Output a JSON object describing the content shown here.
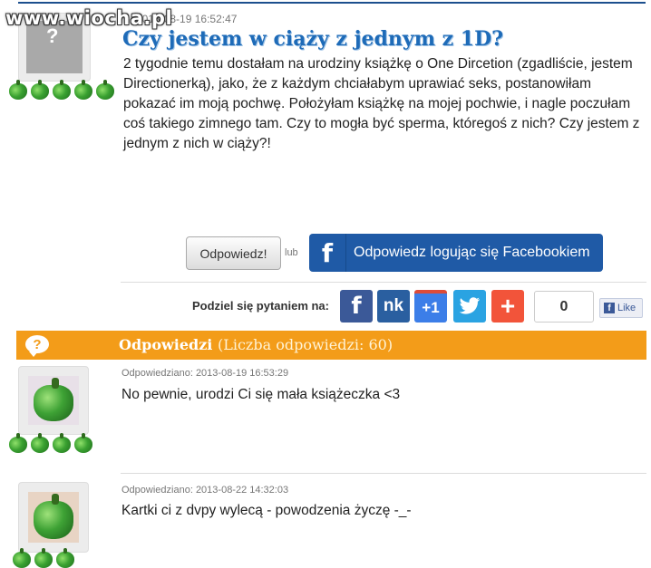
{
  "watermark": "www.wiocha.pl",
  "question": {
    "date": "2013-08-19 16:52:47",
    "title": "Czy jestem w ciąży z jednym z 1D?",
    "body": "2 tygodnie temu dostałam na urodziny książkę o One Dircetion (zgadliście, jestem Directionerką), jako, że z każdym chciałabym uprawiać seks, postanowiłam pokazać im moją pochwę. Położyłam książkę na mojej pochwie, i nagle poczułam coś takiego zimnego tam. Czy to mogła być sperma, któregoś z nich? Czy jestem z jednym z nich w ciąży?!",
    "rating_icons": 5
  },
  "actions": {
    "reply_label": "Odpowiedz!",
    "or_label": "lub",
    "facebook_label": "Odpowiedz logując się Facebookiem"
  },
  "share": {
    "label": "Podziel się pytaniem na:",
    "buttons": [
      {
        "icon": "facebook-icon",
        "text": "f",
        "color": "#3b5998"
      },
      {
        "icon": "nk-icon",
        "text": "nk",
        "color": "#2a5fa0"
      },
      {
        "icon": "google-plus-icon",
        "text": "+1",
        "color": "#3c7ee8"
      },
      {
        "icon": "twitter-icon",
        "text": "🐦",
        "color": "#2aa3e2"
      },
      {
        "icon": "addthis-icon",
        "text": "+",
        "color": "#f2543a"
      }
    ],
    "count": "0",
    "like_label": "Like"
  },
  "answers_header": {
    "title": "Odpowiedzi",
    "count": "(Liczba odpowiedzi: 60)"
  },
  "answers": [
    {
      "date": "Odpowiedziano: 2013-08-19 16:53:29",
      "text": "No pewnie, urodzi Ci się mała książeczka <3",
      "rating_icons": 4
    },
    {
      "date": "Odpowiedziano: 2013-08-22 14:32:03",
      "text": "Kartki ci z dvpy wylecą - powodzenia życzę -_-",
      "rating_icons": 3
    }
  ],
  "colors": {
    "accent_blue": "#1e6bb8",
    "facebook_blue": "#1f5aa6",
    "orange": "#f39c19"
  }
}
